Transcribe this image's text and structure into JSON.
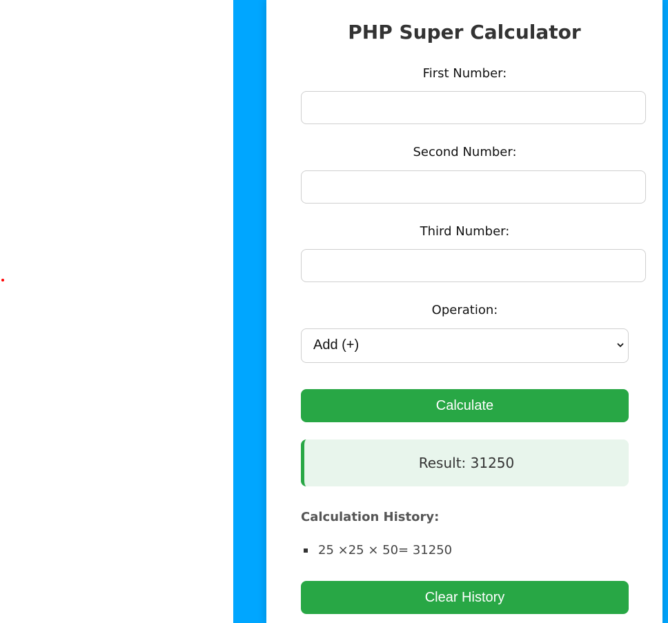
{
  "app": {
    "title": "PHP Super Calculator"
  },
  "form": {
    "first_number": {
      "label": "First Number:",
      "value": "",
      "placeholder": ""
    },
    "second_number": {
      "label": "Second Number:",
      "value": "",
      "placeholder": ""
    },
    "third_number": {
      "label": "Third Number:",
      "value": "",
      "placeholder": ""
    },
    "operation": {
      "label": "Operation:",
      "selected": "Add (+)"
    },
    "calculate_label": "Calculate"
  },
  "result": {
    "text": "Result: 31250"
  },
  "history": {
    "title": "Calculation History:",
    "items": [
      "25 ×25 × 50= 31250"
    ],
    "clear_label": "Clear History"
  },
  "icons": {
    "select_chevron": "chevron-down-icon",
    "list_bullet": "square-bullet-icon"
  },
  "colors": {
    "accent_blue": "#00a6ff",
    "button_green": "#28a745",
    "result_background": "#e8f5ec",
    "marker_red": "#ff0000"
  }
}
